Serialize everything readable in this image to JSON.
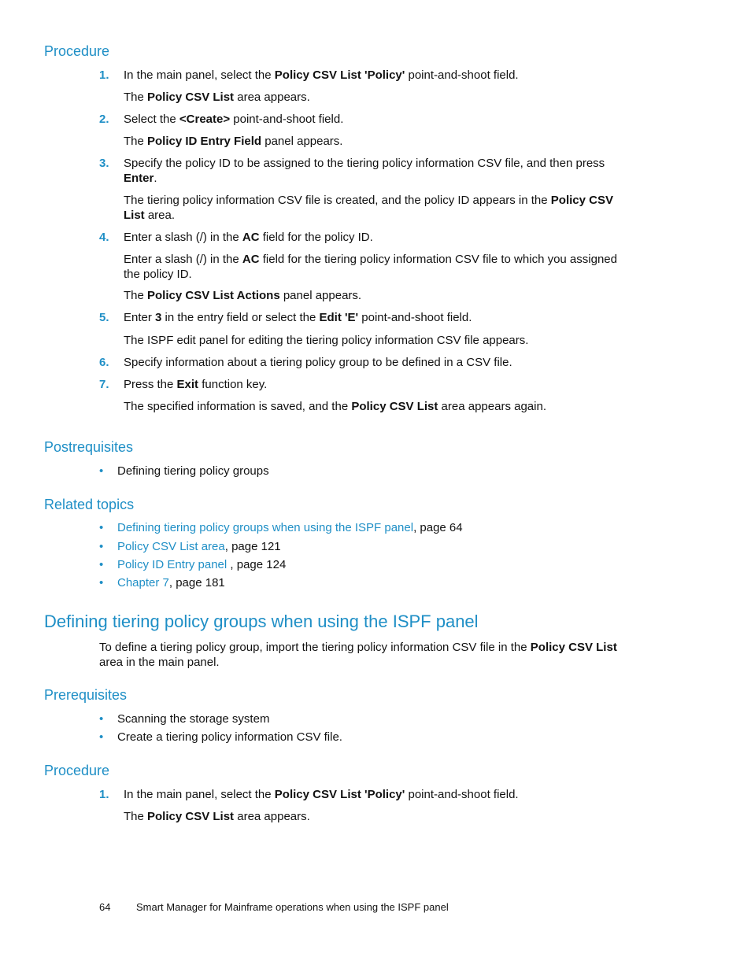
{
  "accent_color": "#1f8fc6",
  "sections": {
    "procedure1_heading": "Procedure",
    "postrequisites_heading": "Postrequisites",
    "related_heading": "Related topics",
    "main_heading": "Defining tiering policy groups when using the ISPF panel",
    "prerequisites_heading": "Prerequisites",
    "procedure2_heading": "Procedure"
  },
  "procedure1": {
    "s1": {
      "num": "1.",
      "a": "In the main panel, select the ",
      "b": "Policy CSV List 'Policy'",
      "c": " point-and-shoot field."
    },
    "r1": {
      "a": "The ",
      "b": "Policy CSV List",
      "c": " area appears."
    },
    "s2": {
      "num": "2.",
      "a": "Select the ",
      "b": "<Create>",
      "c": " point-and-shoot field."
    },
    "r2": {
      "a": "The ",
      "b": "Policy ID Entry Field",
      "c": " panel appears."
    },
    "s3": {
      "num": "3.",
      "a": "Specify the policy ID to be assigned to the tiering policy information CSV file, and then press ",
      "b": "Enter",
      "c": "."
    },
    "r3": {
      "a": "The tiering policy information CSV file is created, and the policy ID appears in the ",
      "b": "Policy CSV List",
      "c": " area."
    },
    "s4": {
      "num": "4.",
      "a": "Enter a slash (/) in the ",
      "b": "AC",
      "c": " field for the policy ID."
    },
    "r4a": {
      "a": "Enter a slash (/) in the ",
      "b": "AC",
      "c": " field for the tiering policy information CSV file to which you assigned the policy ID."
    },
    "r4b": {
      "a": "The ",
      "b": "Policy CSV List Actions",
      "c": " panel appears."
    },
    "s5": {
      "num": "5.",
      "a": "Enter ",
      "b": "3",
      "c": " in the entry field or select the ",
      "d": "Edit 'E'",
      "e": " point-and-shoot field."
    },
    "r5": "The ISPF edit panel for editing the tiering policy information CSV file appears.",
    "s6": {
      "num": "6.",
      "a": "Specify information about a tiering policy group to be defined in a CSV file."
    },
    "s7": {
      "num": "7.",
      "a": "Press the ",
      "b": "Exit",
      "c": " function key."
    },
    "r7": {
      "a": "The specified information is saved, and the ",
      "b": "Policy CSV List",
      "c": " area appears again."
    }
  },
  "postrequisites": [
    "Defining tiering policy groups"
  ],
  "related_topics": [
    {
      "link": "Defining tiering policy groups when using the ISPF panel",
      "suffix": ", page 64"
    },
    {
      "link": "Policy CSV List area",
      "suffix": ", page 121"
    },
    {
      "link": "Policy ID Entry panel",
      "suffix": " , page 124"
    },
    {
      "link": "Chapter 7",
      "suffix": ", page 181"
    }
  ],
  "intro": {
    "a": "To define a tiering policy group, import the tiering policy information CSV file in the ",
    "b": "Policy CSV List",
    "c": " area in the main panel."
  },
  "prerequisites": [
    "Scanning the storage system",
    "Create a tiering policy information CSV file."
  ],
  "procedure2": {
    "s1": {
      "num": "1.",
      "a": "In the main panel, select the ",
      "b": "Policy CSV List 'Policy'",
      "c": " point-and-shoot field."
    },
    "r1": {
      "a": "The ",
      "b": "Policy CSV List",
      "c": " area appears."
    }
  },
  "footer": {
    "page": "64",
    "title": "Smart Manager for Mainframe operations when using the ISPF panel"
  },
  "bullet_char": "•"
}
